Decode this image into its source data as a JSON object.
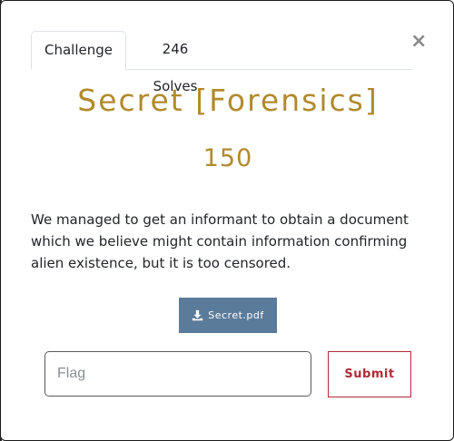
{
  "modal": {
    "close_label": "×",
    "tabs": [
      {
        "label": "Challenge",
        "active": true
      },
      {
        "label": "246 Solves",
        "active": false
      }
    ]
  },
  "challenge": {
    "title": "Secret [Forensics]",
    "points": "150",
    "description": "We managed to get an informant to obtain a document which we believe might contain information confirming alien existence, but it is too censored.",
    "file_label": "Secret.pdf"
  },
  "form": {
    "flag_placeholder": "Flag",
    "flag_value": "",
    "submit_label": "Submit"
  },
  "colors": {
    "title": "#b18a2c",
    "file_button": "#5b7b9a",
    "submit": "#b02a37"
  },
  "icons": {
    "file": "download-icon",
    "close": "close-icon"
  }
}
